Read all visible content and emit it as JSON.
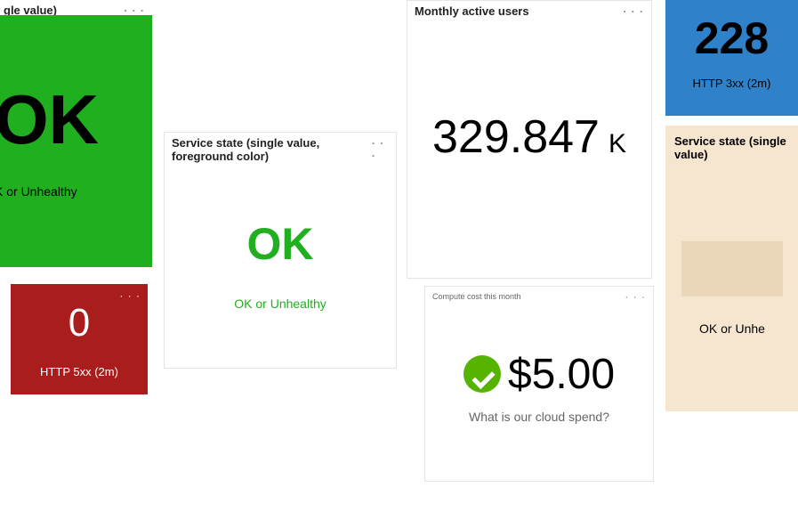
{
  "tiles": {
    "serviceStateGreen": {
      "title": "gle value)",
      "value": "OK",
      "caption": "K or Unhealthy"
    },
    "http5xx": {
      "value": "0",
      "label": "HTTP 5xx (2m)"
    },
    "serviceStateFg": {
      "title": "Service state (single value, foreground color)",
      "value": "OK",
      "caption": "OK or Unhealthy"
    },
    "mau": {
      "title": "Monthly active users",
      "value": "329.847",
      "unit": "K"
    },
    "cost": {
      "title": "Compute cost this month",
      "value": "$5.00",
      "caption": "What is our cloud spend?"
    },
    "http3xx": {
      "value": "228",
      "label": "HTTP 3xx (2m)"
    },
    "serviceStateBeige": {
      "title": "Service state (single value)",
      "caption": "OK or Unhe"
    }
  }
}
